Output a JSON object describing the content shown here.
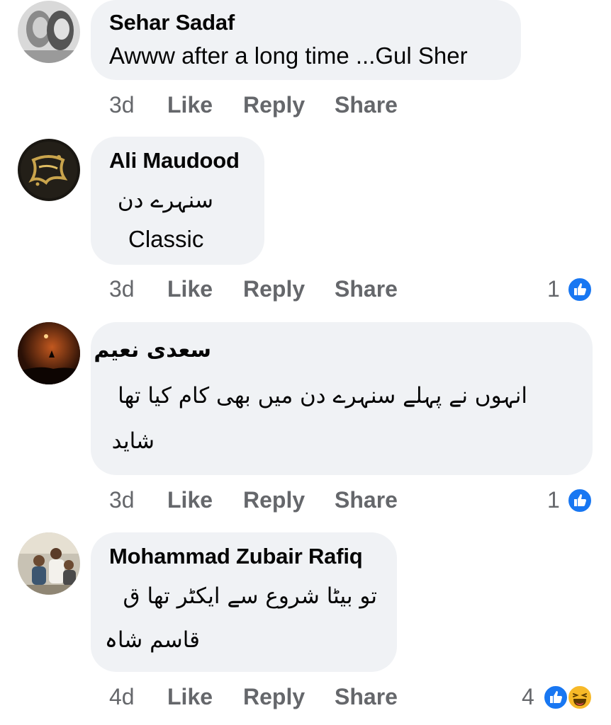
{
  "comments": [
    {
      "author": "Sehar Sadaf",
      "lines": [
        "Awww after a long time ...Gul Sher"
      ],
      "time": "3d",
      "like": "Like",
      "reply": "Reply",
      "share": "Share",
      "reaction_count": "",
      "avatar_icon": "two-women-photo"
    },
    {
      "author": "Ali Maudood",
      "lines": [
        "سنہرے دن",
        "Classic"
      ],
      "time": "3d",
      "like": "Like",
      "reply": "Reply",
      "share": "Share",
      "reaction_count": "1",
      "reactions": [
        "like-icon"
      ],
      "avatar_icon": "muhammad-calligraphy-gold"
    },
    {
      "author": "سعدی نعیم",
      "lines": [
        "انہوں نے پہلے سنہرے دن میں بھی کام کیا تھا",
        "شاید"
      ],
      "time": "3d",
      "like": "Like",
      "reply": "Reply",
      "share": "Share",
      "reaction_count": "1",
      "reactions": [
        "like-icon"
      ],
      "avatar_icon": "night-silhouette-photo"
    },
    {
      "author": "Mohammad Zubair Rafiq",
      "lines": [
        "تو بیٹا شروع سے ایکٹر تھا ق",
        "قاسم شاہ"
      ],
      "time": "4d",
      "like": "Like",
      "reply": "Reply",
      "share": "Share",
      "reaction_count": "4",
      "reactions": [
        "like-icon",
        "haha-icon"
      ],
      "avatar_icon": "group-photo"
    }
  ],
  "colors": {
    "bubble": "#f0f2f5",
    "secondary_text": "#65676b",
    "like_blue": "#1877f2",
    "haha_yellow": "#f7b928"
  }
}
